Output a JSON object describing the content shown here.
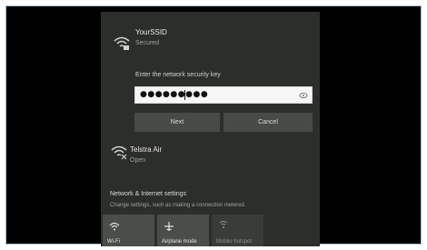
{
  "networks": [
    {
      "name": "YourSSID",
      "status": "Secured",
      "icon": "wifi-secured-icon"
    },
    {
      "name": "Telstra Air",
      "status": "Open",
      "icon": "wifi-open-icon"
    }
  ],
  "connect_form": {
    "prompt": "Enter the network security key",
    "value": "●●●●●●●●●",
    "next_label": "Next",
    "cancel_label": "Cancel"
  },
  "settings": {
    "title": "Network & Internet settings",
    "description": "Change settings, such as making a connection metered."
  },
  "quick_actions": [
    {
      "label": "Wi-Fi",
      "icon": "wifi-icon",
      "state": "on"
    },
    {
      "label": "Airplane mode",
      "icon": "airplane-icon",
      "state": "on"
    },
    {
      "label": "Mobile hotspot",
      "icon": "hotspot-icon",
      "state": "off"
    }
  ],
  "colors": {
    "panel": "#2c2e2b",
    "button": "#474a47",
    "input_bg": "#f6f6f6",
    "frame_border": "#a9bfd4"
  }
}
